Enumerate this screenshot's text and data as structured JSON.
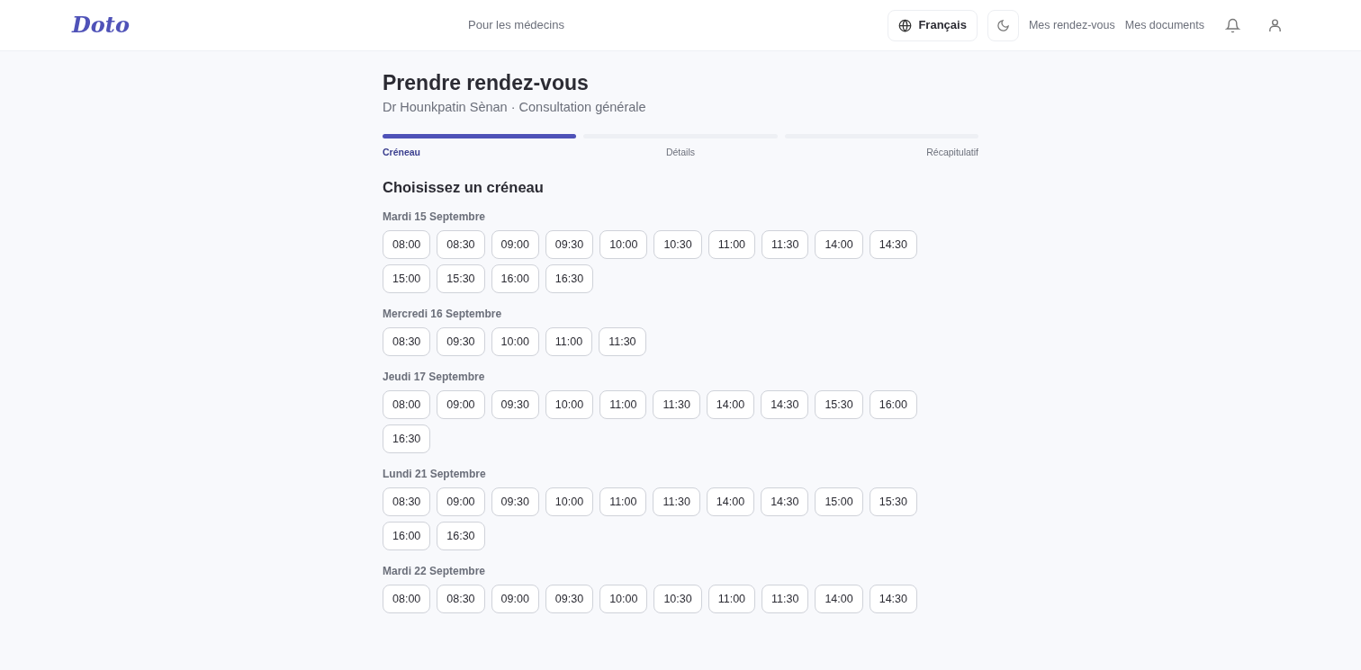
{
  "header": {
    "logo": "Doto",
    "center_link": "Pour les médecins",
    "language": "Français",
    "nav_links": [
      "Mes rendez-vous",
      "Mes documents"
    ]
  },
  "title": "Prendre rendez-vous",
  "subtitle": "Dr Hounkpatin Sènan · Consultation générale",
  "steps": [
    {
      "label": "Créneau",
      "selected": true
    },
    {
      "label": "Détails",
      "selected": false
    },
    {
      "label": "Récapitulatif",
      "selected": false
    }
  ],
  "section_title": "Choisissez un créneau",
  "days": [
    {
      "label": "Mardi 15 Septembre",
      "slots": [
        "08:00",
        "08:30",
        "09:00",
        "09:30",
        "10:00",
        "10:30",
        "11:00",
        "11:30",
        "14:00",
        "14:30",
        "15:00",
        "15:30",
        "16:00",
        "16:30"
      ]
    },
    {
      "label": "Mercredi 16 Septembre",
      "slots": [
        "08:30",
        "09:30",
        "10:00",
        "11:00",
        "11:30"
      ]
    },
    {
      "label": "Jeudi 17 Septembre",
      "slots": [
        "08:00",
        "09:00",
        "09:30",
        "10:00",
        "11:00",
        "11:30",
        "14:00",
        "14:30",
        "15:30",
        "16:00",
        "16:30"
      ]
    },
    {
      "label": "Lundi 21 Septembre",
      "slots": [
        "08:30",
        "09:00",
        "09:30",
        "10:00",
        "11:00",
        "11:30",
        "14:00",
        "14:30",
        "15:00",
        "15:30",
        "16:00",
        "16:30"
      ]
    },
    {
      "label": "Mardi 22 Septembre",
      "slots": [
        "08:00",
        "08:30",
        "09:00",
        "09:30",
        "10:00",
        "10:30",
        "11:00",
        "11:30",
        "14:00",
        "14:30"
      ]
    }
  ]
}
